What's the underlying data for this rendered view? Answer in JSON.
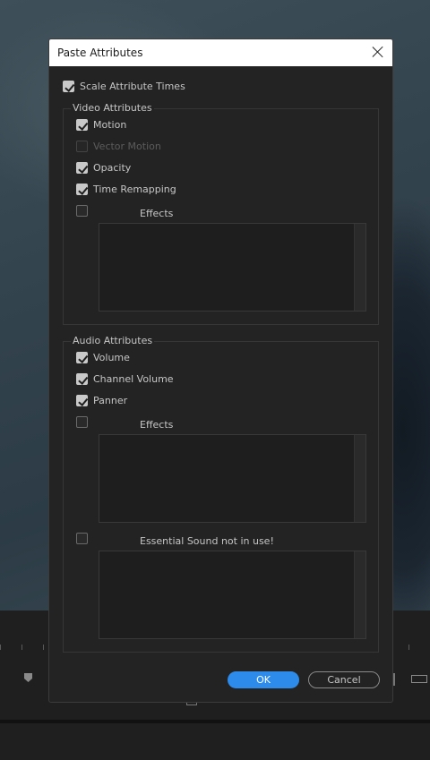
{
  "dialog": {
    "title": "Paste Attributes",
    "scale_attribute_times": {
      "label": "Scale Attribute Times",
      "checked": true
    },
    "video": {
      "title": "Video Attributes",
      "items": [
        {
          "label": "Motion",
          "checked": true,
          "enabled": true
        },
        {
          "label": "Vector Motion",
          "checked": false,
          "enabled": false
        },
        {
          "label": "Opacity",
          "checked": true,
          "enabled": true
        },
        {
          "label": "Time Remapping",
          "checked": true,
          "enabled": true
        }
      ],
      "effects": {
        "label": "Effects",
        "checked": false
      }
    },
    "audio": {
      "title": "Audio Attributes",
      "items": [
        {
          "label": "Volume",
          "checked": true
        },
        {
          "label": "Channel Volume",
          "checked": true
        },
        {
          "label": "Panner",
          "checked": true
        }
      ],
      "effects": {
        "label": "Effects",
        "checked": false
      },
      "essential_sound": {
        "label": "Essential Sound not in use!",
        "checked": false
      }
    },
    "ok_label": "OK",
    "cancel_label": "Cancel"
  },
  "colors": {
    "accent": "#2d8ceb",
    "dialog_bg": "#232323",
    "titlebar_bg": "#ffffff"
  }
}
